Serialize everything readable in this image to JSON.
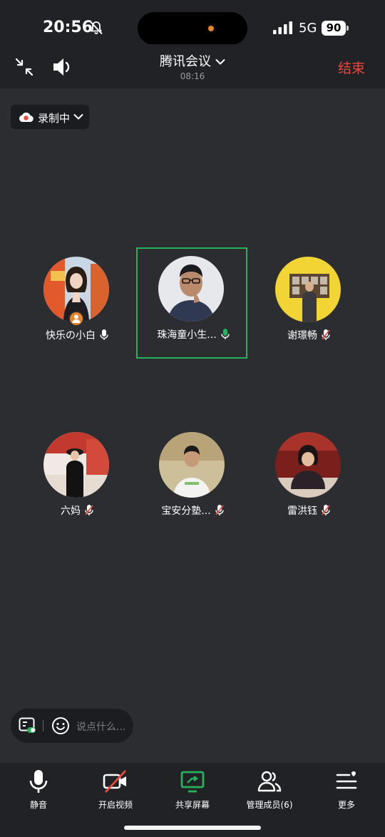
{
  "status_bar": {
    "time": "20:56",
    "network": "5G",
    "battery": "90"
  },
  "header": {
    "title": "腾讯会议",
    "timer": "08:16",
    "end_label": "结束"
  },
  "recording": {
    "label": "录制中"
  },
  "participants": [
    {
      "name": "快乐の小白",
      "mic": "on",
      "host": true
    },
    {
      "name": "珠海童小生...",
      "mic": "speaking",
      "active": true
    },
    {
      "name": "谢璟畅",
      "mic": "muted"
    },
    {
      "name": "六妈",
      "mic": "muted"
    },
    {
      "name": "宝安分塾...",
      "mic": "muted"
    },
    {
      "name": "雷洪钰",
      "mic": "muted"
    }
  ],
  "chat": {
    "placeholder": "说点什么..."
  },
  "toolbar": {
    "mute": "静音",
    "video": "开启视频",
    "share": "共享屏幕",
    "members": "管理成员(6)",
    "more": "更多"
  },
  "colors": {
    "accent_green": "#25b25a",
    "end_red": "#e8493f",
    "host_orange": "#e8862d",
    "background": "#2b2d30"
  }
}
